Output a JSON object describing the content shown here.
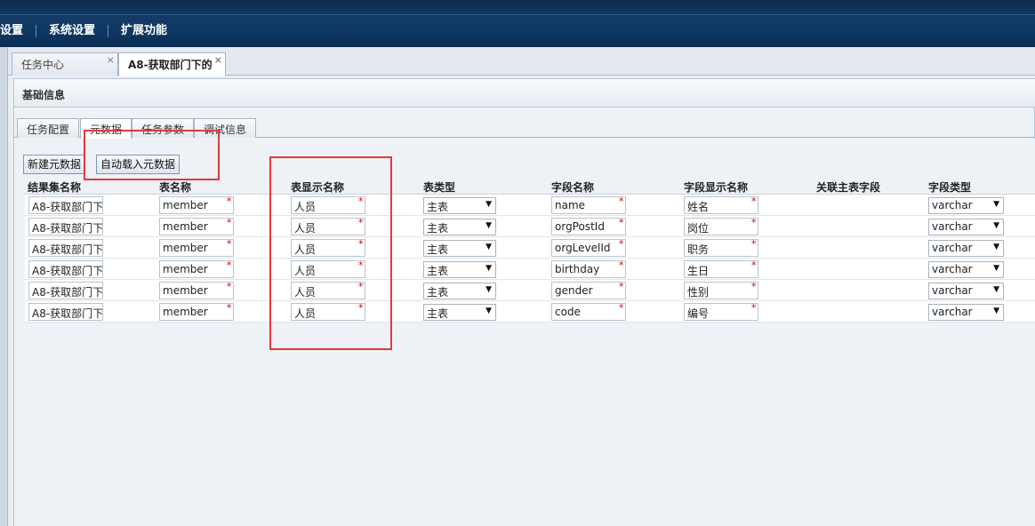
{
  "nav": {
    "items": [
      "设置",
      "系统设置",
      "扩展功能"
    ]
  },
  "tabs": [
    {
      "label": "任务中心",
      "close": "×"
    },
    {
      "label": "A8-获取部门下的",
      "close": "×"
    }
  ],
  "section": {
    "title": "基础信息"
  },
  "subtabs": [
    "任务配置",
    "元数据",
    "任务参数",
    "调试信息"
  ],
  "buttons": {
    "new_meta": "新建元数据",
    "auto_load": "自动载入元数据"
  },
  "grid": {
    "headers": [
      "结果集名称",
      "表名称",
      "表显示名称",
      "表类型",
      "字段名称",
      "字段显示名称",
      "关联主表字段",
      "字段类型"
    ],
    "required_mark": "*",
    "select_arrow": "▼",
    "rows": [
      {
        "result_set": "A8-获取部门下",
        "table": "member",
        "display": "人员",
        "type": "主表",
        "field": "name",
        "field_display": "姓名",
        "related": "",
        "field_type": "varchar"
      },
      {
        "result_set": "A8-获取部门下",
        "table": "member",
        "display": "人员",
        "type": "主表",
        "field": "orgPostId",
        "field_display": "岗位",
        "related": "",
        "field_type": "varchar"
      },
      {
        "result_set": "A8-获取部门下",
        "table": "member",
        "display": "人员",
        "type": "主表",
        "field": "orgLevelId",
        "field_display": "职务",
        "related": "",
        "field_type": "varchar"
      },
      {
        "result_set": "A8-获取部门下",
        "table": "member",
        "display": "人员",
        "type": "主表",
        "field": "birthday",
        "field_display": "生日",
        "related": "",
        "field_type": "varchar"
      },
      {
        "result_set": "A8-获取部门下",
        "table": "member",
        "display": "人员",
        "type": "主表",
        "field": "gender",
        "field_display": "性别",
        "related": "",
        "field_type": "varchar"
      },
      {
        "result_set": "A8-获取部门下",
        "table": "member",
        "display": "人员",
        "type": "主表",
        "field": "code",
        "field_display": "编号",
        "related": "",
        "field_type": "varchar"
      }
    ]
  },
  "colors": {
    "nav_bg": "#0f3a66",
    "annotation": "#e03a3a",
    "required": "#cc0000"
  }
}
